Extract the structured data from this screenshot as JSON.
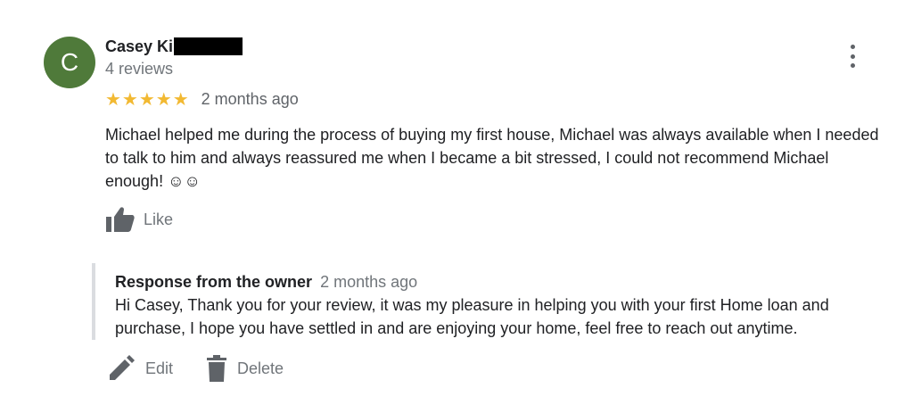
{
  "review": {
    "avatar_letter": "C",
    "avatar_color": "#4f7a3a",
    "reviewer_name": "Casey Ki",
    "review_count": "4 reviews",
    "rating_stars": "★★★★★",
    "rating_value": 5,
    "date": "2 months ago",
    "text": "Michael helped me during the process of buying my first house, Michael was always available when I needed to talk to him and always reassured me when I became a bit stressed, I could not recommend Michael enough! ☺☺",
    "like_label": "Like",
    "more_icon": "more-vert-icon"
  },
  "owner_response": {
    "title": "Response from the owner",
    "date": "2 months ago",
    "text": "Hi Casey, Thank you for your review, it was my pleasure in helping you with your first Home loan and purchase, I hope you have settled in and are enjoying your home, feel free to reach out anytime."
  },
  "actions": {
    "edit_label": "Edit",
    "delete_label": "Delete"
  },
  "colors": {
    "star": "#f2b932",
    "secondary_text": "#70757a",
    "icon": "#5f6368"
  }
}
